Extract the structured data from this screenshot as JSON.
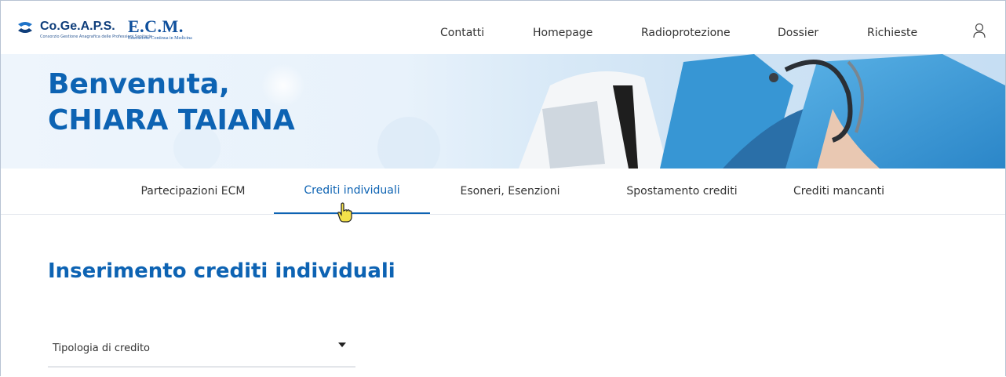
{
  "header": {
    "brand_name": "Co.Ge.A.P.S.",
    "brand_sub": "Consorzio Gestione Anagrafica delle Professioni Sanitarie",
    "ecm_title": "E.C.M.",
    "ecm_sub": "Educazione Continua in Medicina",
    "nav": [
      "Contatti",
      "Homepage",
      "Radioprotezione",
      "Dossier",
      "Richieste"
    ],
    "user_icon": "user-icon"
  },
  "hero": {
    "greeting_line1": "Benvenuta,",
    "greeting_line2": "CHIARA TAIANA"
  },
  "tabs": [
    {
      "label": "Partecipazioni ECM",
      "active": false
    },
    {
      "label": "Crediti individuali",
      "active": true
    },
    {
      "label": "Esoneri, Esenzioni",
      "active": false
    },
    {
      "label": "Spostamento crediti",
      "active": false
    },
    {
      "label": "Crediti mancanti",
      "active": false
    }
  ],
  "main": {
    "title": "Inserimento crediti individuali",
    "select_label": "Tipologia di credito"
  },
  "colors": {
    "accent": "#0d63b3",
    "brand_dark": "#0f3e7b"
  }
}
